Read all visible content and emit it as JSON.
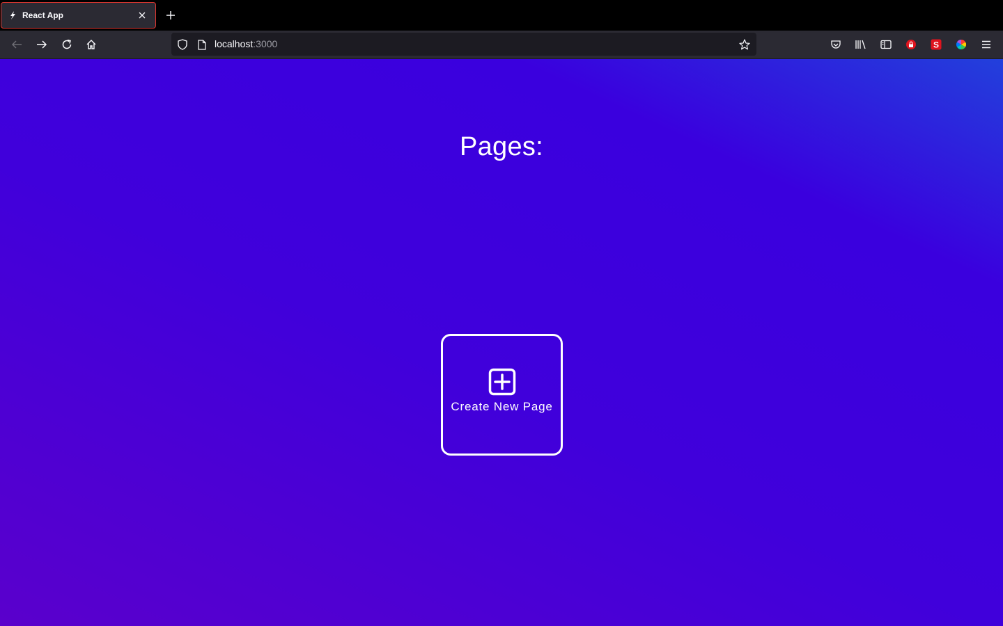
{
  "browser": {
    "tab": {
      "title": "React App"
    },
    "url": {
      "host": "localhost",
      "port": ":3000"
    },
    "icons": {
      "back": "back-arrow-icon",
      "forward": "forward-arrow-icon",
      "reload": "reload-icon",
      "home": "home-icon",
      "shield": "shield-icon",
      "page": "page-icon",
      "bookmark": "star-icon",
      "pocket": "pocket-icon",
      "library": "library-icon",
      "sidebar": "sidebar-icon",
      "ext_lock": "lock-extension-icon",
      "ext_s": "s-extension-icon",
      "ext_color": "color-wheel-icon",
      "menu": "hamburger-menu-icon"
    },
    "colors": {
      "tab_border": "#e0362f",
      "ext_red": "#e0141e"
    }
  },
  "main": {
    "heading": "Pages:",
    "create_card": {
      "label": "Create New Page",
      "icon": "plus-square-icon"
    }
  },
  "colors": {
    "gradient_top_right": "#2240dc",
    "gradient_mid": "#3a00de",
    "gradient_bottom_left": "#5a00cc",
    "text": "#ffffff"
  }
}
